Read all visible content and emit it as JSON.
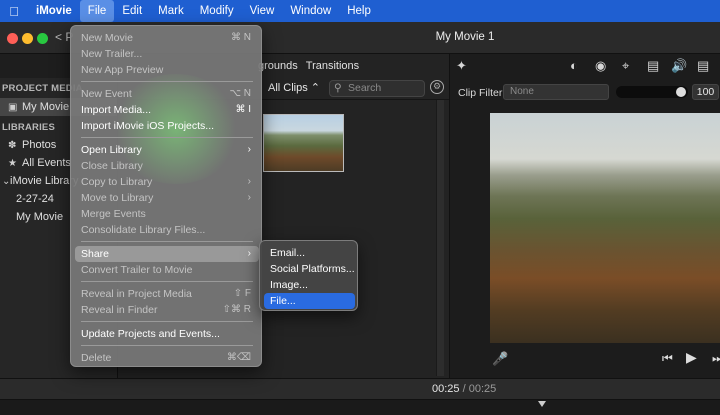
{
  "menubar": {
    "apple_icon": "apple-logo",
    "app_name": "iMovie",
    "items": [
      "File",
      "Edit",
      "Mark",
      "Modify",
      "View",
      "Window",
      "Help"
    ]
  },
  "window": {
    "title": "My Movie 1",
    "back_label": "< P"
  },
  "sidebar": {
    "project_media_header": "PROJECT MEDIA",
    "project_item": "My Movie",
    "libraries_header": "LIBRARIES",
    "items": [
      {
        "label": "Photos",
        "icon": "photos-icon"
      },
      {
        "label": "All Events",
        "icon": "star-icon"
      },
      {
        "label": "iMovie Library",
        "icon": "disclosure-icon"
      },
      {
        "label": "2-27-24"
      },
      {
        "label": "My Movie"
      }
    ]
  },
  "browser": {
    "tabs": [
      "grounds",
      "Transitions"
    ],
    "filter_label": "All Clips ⌃",
    "search_placeholder": "Search"
  },
  "viewer": {
    "clip_filter_label": "Clip Filter:",
    "clip_filter_value": "None",
    "volume_value": "100",
    "volume_fraction": 1.0
  },
  "timebar": {
    "current": "00:25",
    "separator": " / ",
    "total": "00:25"
  },
  "file_menu": {
    "groups": [
      [
        {
          "label": "New Movie",
          "shortcut": "⌘ N",
          "disabled": true
        },
        {
          "label": "New Trailer...",
          "shortcut": "",
          "disabled": true
        },
        {
          "label": "New App Preview",
          "shortcut": "",
          "disabled": true
        }
      ],
      [
        {
          "label": "New Event",
          "shortcut": "⌥ N",
          "disabled": true
        },
        {
          "label": "Import Media...",
          "shortcut": "⌘ I",
          "disabled": false
        },
        {
          "label": "Import iMovie iOS Projects...",
          "shortcut": "",
          "disabled": false
        }
      ],
      [
        {
          "label": "Open Library",
          "arrow": true,
          "disabled": false
        },
        {
          "label": "Close Library",
          "disabled": true
        },
        {
          "label": "Copy to Library",
          "arrow": true,
          "disabled": true
        },
        {
          "label": "Move to Library",
          "arrow": true,
          "disabled": true
        },
        {
          "label": "Merge Events",
          "disabled": true
        },
        {
          "label": "Consolidate Library Files...",
          "disabled": true
        }
      ],
      [
        {
          "label": "Share",
          "arrow": true,
          "disabled": false,
          "highlighted": true
        },
        {
          "label": "Convert Trailer to Movie",
          "disabled": true
        }
      ],
      [
        {
          "label": "Reveal in Project Media",
          "shortcut": "⇧ F",
          "disabled": true
        },
        {
          "label": "Reveal in Finder",
          "shortcut": "⇧⌘ R",
          "disabled": true
        }
      ],
      [
        {
          "label": "Update Projects and Events...",
          "disabled": false
        }
      ],
      [
        {
          "label": "Delete",
          "shortcut": "⌘⌫",
          "disabled": true
        }
      ]
    ]
  },
  "share_submenu": {
    "items": [
      {
        "label": "Email...",
        "selected": false
      },
      {
        "label": "Social Platforms...",
        "selected": false
      },
      {
        "label": "Image...",
        "selected": false
      },
      {
        "label": "File...",
        "selected": true
      }
    ]
  }
}
